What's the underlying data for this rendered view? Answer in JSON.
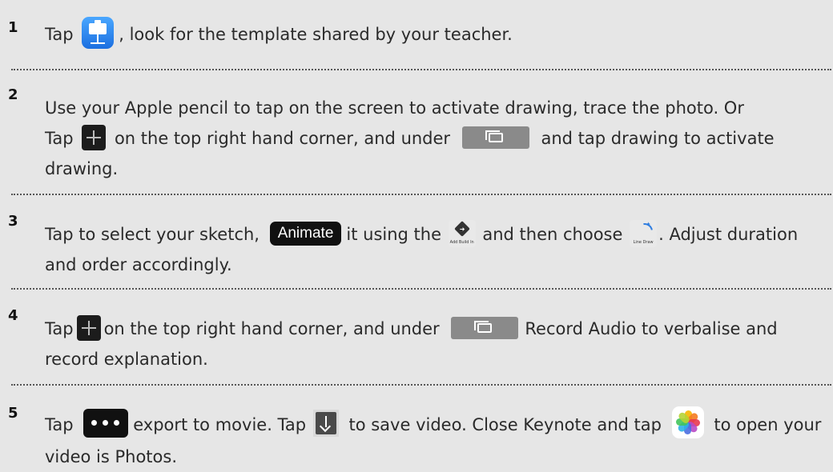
{
  "steps": [
    {
      "number": "1",
      "parts": [
        "Tap",
        ", look for the template shared by your teacher."
      ]
    },
    {
      "number": "2",
      "parts": [
        "Use your Apple pencil to tap on the screen to activate drawing, trace the photo.  Or",
        "Tap",
        "on the top right hand corner, and under",
        "and tap drawing to activate drawing."
      ]
    },
    {
      "number": "3",
      "parts": [
        "Tap to select your sketch,",
        "it using the",
        "and then choose",
        ". Adjust duration and order accordingly."
      ]
    },
    {
      "number": "4",
      "parts": [
        "Tap",
        "on the top right hand corner, and under",
        "Record Audio to verbalise and record explanation."
      ]
    },
    {
      "number": "5",
      "parts": [
        "Tap",
        "export to movie. Tap",
        "to save video. Close Keynote and tap",
        "to open your video is Photos."
      ]
    }
  ],
  "buttons": {
    "animate": "Animate",
    "add_build_caption": "Add Build In",
    "line_draw_caption": "Line Draw"
  },
  "icons": {
    "keynote": "keynote-app-icon",
    "plus": "plus-icon",
    "media": "media-icon",
    "add_build": "add-build-icon",
    "line_draw": "line-draw-icon",
    "more": "more-icon",
    "save": "save-download-icon",
    "photos": "photos-app-icon"
  },
  "colors": {
    "background": "#e6e6e6",
    "keynote_blue": "#1b6fe0",
    "dark_button": "#111111",
    "media_grey": "#8a8a8a"
  }
}
